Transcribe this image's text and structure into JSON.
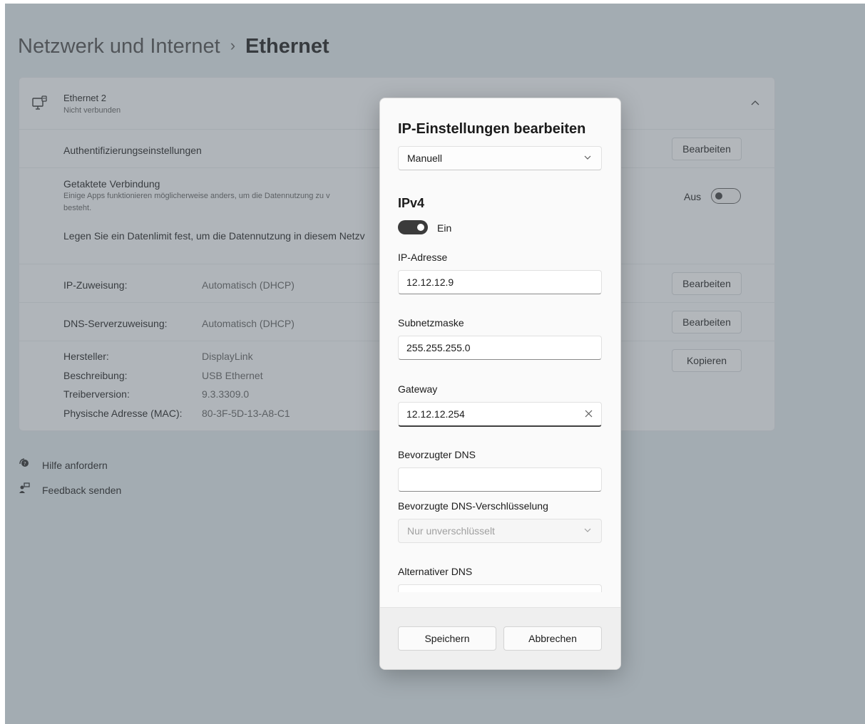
{
  "breadcrumb": {
    "parent": "Netzwerk und Internet",
    "separator": "›",
    "current": "Ethernet"
  },
  "adapter": {
    "name": "Ethernet 2",
    "status": "Nicht verbunden",
    "collapse_icon": "chevron-up-icon",
    "icon": "network-adapter-icon"
  },
  "auth": {
    "label": "Authentifizierungseinstellungen",
    "button": "Bearbeiten"
  },
  "metered": {
    "title": "Getaktete Verbindung",
    "desc_line1": "Einige Apps funktionieren möglicherweise anders, um die Datennutzung zu v",
    "desc_line2": "besteht.",
    "toggle_label": "Aus",
    "toggle_on": false,
    "limit_text": "Legen Sie ein Datenlimit fest, um die Datennutzung in diesem Netzv"
  },
  "ip_assignment": {
    "label": "IP-Zuweisung:",
    "value": "Automatisch (DHCP)",
    "button": "Bearbeiten"
  },
  "dns_assignment": {
    "label": "DNS-Serverzuweisung:",
    "value": "Automatisch (DHCP)",
    "button": "Bearbeiten"
  },
  "properties": {
    "copy_button": "Kopieren",
    "items": [
      {
        "label": "Hersteller:",
        "value": "DisplayLink"
      },
      {
        "label": "Beschreibung:",
        "value": "USB Ethernet"
      },
      {
        "label": "Treiberversion:",
        "value": "9.3.3309.0"
      },
      {
        "label": "Physische Adresse (MAC):",
        "value": "80-3F-5D-13-A8-C1"
      }
    ]
  },
  "links": [
    {
      "label": "Hilfe anfordern",
      "icon": "help-icon"
    },
    {
      "label": "Feedback senden",
      "icon": "feedback-icon"
    }
  ],
  "dialog": {
    "title": "IP-Einstellungen bearbeiten",
    "mode": "Manuell",
    "ipv4_heading": "IPv4",
    "ipv4_toggle_label": "Ein",
    "ipv4_on": true,
    "ip_label": "IP-Adresse",
    "ip_value": "12.12.12.9",
    "subnet_label": "Subnetzmaske",
    "subnet_value": "255.255.255.0",
    "gateway_label": "Gateway",
    "gateway_value": "12.12.12.254",
    "dns_label": "Bevorzugter DNS",
    "dns_value": "",
    "dns_enc_label": "Bevorzugte DNS-Verschlüsselung",
    "dns_enc_value": "Nur unverschlüsselt",
    "alt_dns_label": "Alternativer DNS",
    "save": "Speichern",
    "cancel": "Abbrechen"
  }
}
